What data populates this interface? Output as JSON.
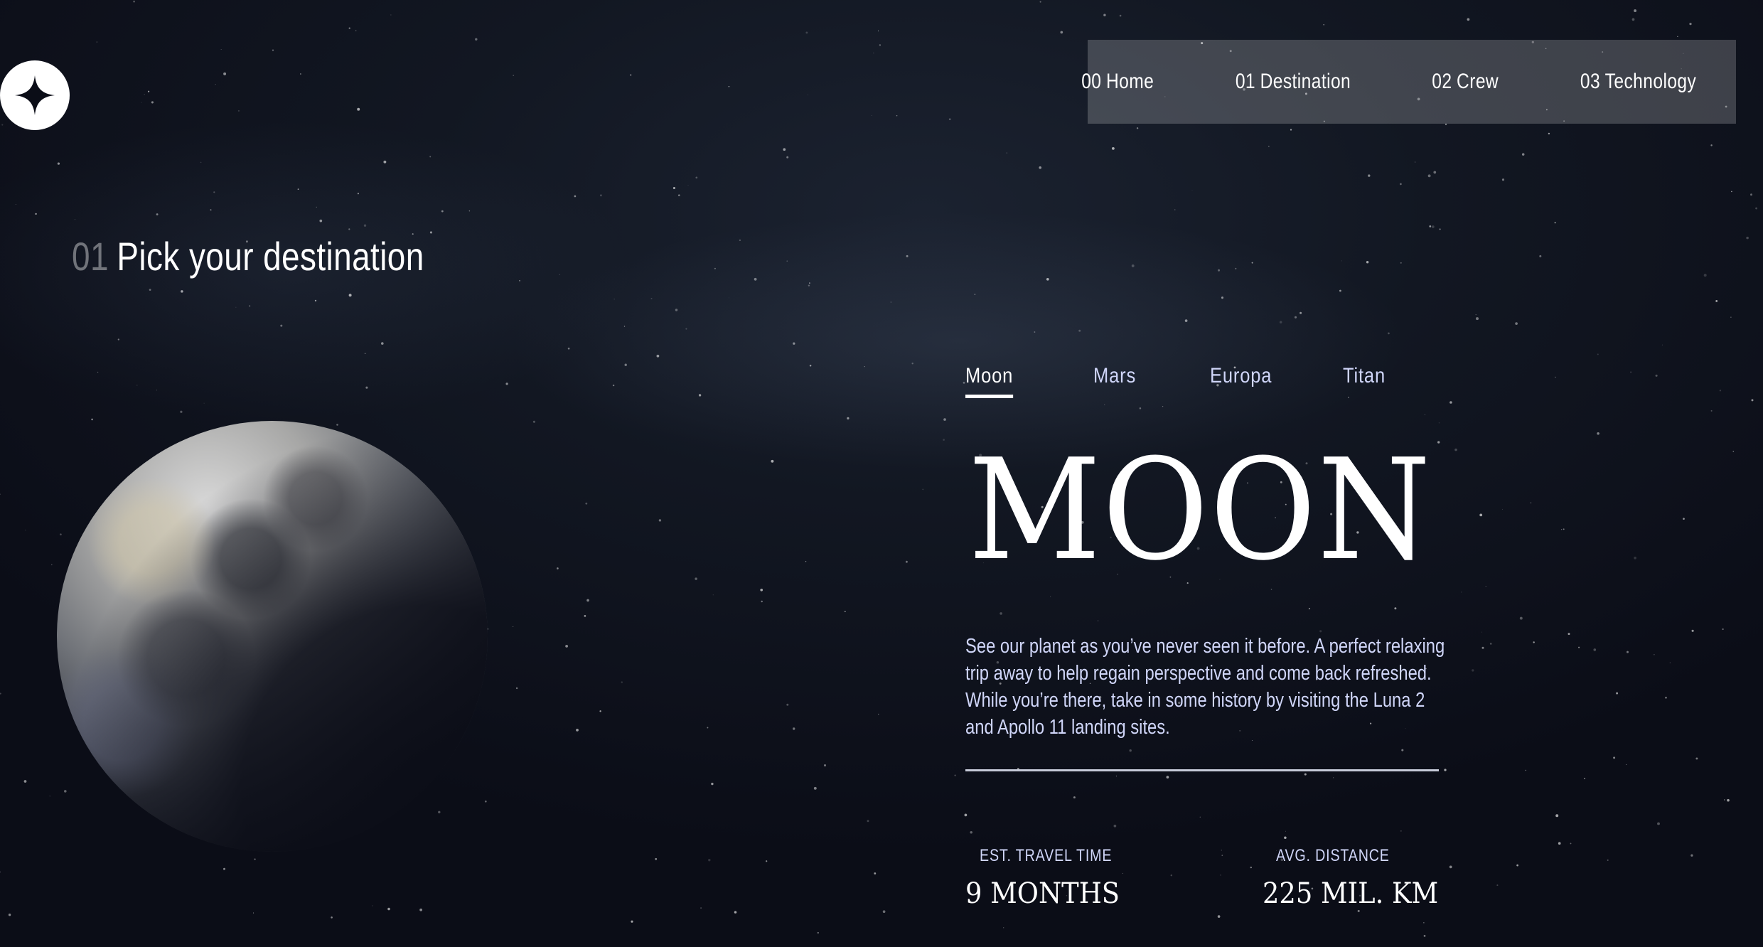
{
  "header": {
    "logo_icon": "star-logo-icon",
    "nav": [
      {
        "num": "00",
        "label": "Home"
      },
      {
        "num": "01",
        "label": "Destination"
      },
      {
        "num": "02",
        "label": "Crew"
      },
      {
        "num": "03",
        "label": "Technology"
      }
    ]
  },
  "page": {
    "heading_num": "01",
    "heading": "Pick your destination"
  },
  "tabs": [
    {
      "label": "Moon",
      "active": true
    },
    {
      "label": "Mars",
      "active": false
    },
    {
      "label": "Europa",
      "active": false
    },
    {
      "label": "Titan",
      "active": false
    }
  ],
  "destination": {
    "name": "MOON",
    "description": "See our planet as you’ve never seen it before. A perfect relaxing trip away to help regain perspective and come back refreshed. While you’re there, take in some history by visiting the Luna 2 and Apollo 11 landing sites.",
    "image": "moon-image",
    "stats": [
      {
        "label": "EST. TRAVEL TIME",
        "value": "9 MONTHS"
      },
      {
        "label": "AVG. DISTANCE",
        "value": "225 MIL. KM"
      }
    ]
  },
  "colors": {
    "background": "#0b0d17",
    "text": "#ffffff",
    "muted": "#d0d6f9",
    "nav_bg": "rgba(255,255,255,0.20)"
  }
}
